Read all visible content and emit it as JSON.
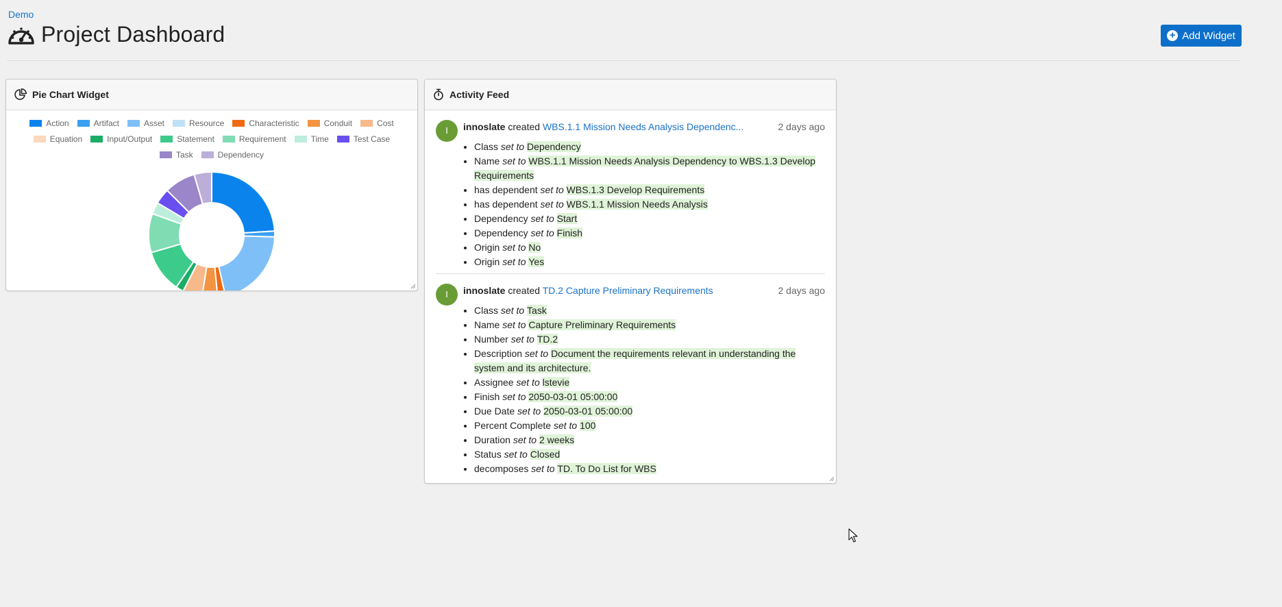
{
  "breadcrumb": "Demo",
  "page_title": "Project Dashboard",
  "add_widget_label": "Add Widget",
  "pie_widget": {
    "title": "Pie Chart Widget",
    "chart_data": {
      "type": "pie",
      "legend_placement": "top",
      "categories": [
        "Action",
        "Artifact",
        "Asset",
        "Resource",
        "Characteristic",
        "Conduit",
        "Cost",
        "Equation",
        "Input/Output",
        "Statement",
        "Requirement",
        "Time",
        "Test Case",
        "Task",
        "Dependency"
      ],
      "values": [
        24,
        1.5,
        21,
        0,
        2,
        4,
        5,
        0,
        2,
        11,
        10,
        3,
        4,
        8,
        4.5
      ],
      "colors": [
        "#0a84ec",
        "#3aa0f0",
        "#7fbff7",
        "#bfe0f7",
        "#ef6a12",
        "#f29442",
        "#f7b98a",
        "#fbd9bd",
        "#1aad66",
        "#3ccb8a",
        "#7fdcb3",
        "#bdeedb",
        "#6a4ff0",
        "#9a86c9",
        "#bcaed9"
      ]
    }
  },
  "activity_feed": {
    "title": "Activity Feed",
    "set_to_label": "set to",
    "entries": [
      {
        "avatar": "I",
        "user": "innoslate",
        "verb": "created",
        "target": "WBS.1.1 Mission Needs Analysis Dependenc...",
        "time": "2 days ago",
        "changes": [
          {
            "field": "Class",
            "value": "Dependency"
          },
          {
            "field": "Name",
            "value": "WBS.1.1 Mission Needs Analysis Dependency to WBS.1.3 Develop Requirements"
          },
          {
            "field": "has dependent",
            "value": "WBS.1.3 Develop Requirements"
          },
          {
            "field": "has dependent",
            "value": "WBS.1.1 Mission Needs Analysis"
          },
          {
            "field": "Dependency",
            "value": "Start"
          },
          {
            "field": "Dependency",
            "value": "Finish"
          },
          {
            "field": "Origin",
            "value": "No"
          },
          {
            "field": "Origin",
            "value": "Yes"
          }
        ]
      },
      {
        "avatar": "I",
        "user": "innoslate",
        "verb": "created",
        "target": "TD.2 Capture Preliminary Requirements",
        "time": "2 days ago",
        "changes": [
          {
            "field": "Class",
            "value": "Task"
          },
          {
            "field": "Name",
            "value": "Capture Preliminary Requirements"
          },
          {
            "field": "Number",
            "value": "TD.2"
          },
          {
            "field": "Description",
            "value": "Document the requirements relevant in understanding the system and its architecture."
          },
          {
            "field": "Assignee",
            "value": "lstevie"
          },
          {
            "field": "Finish",
            "value": "2050-03-01 05:00:00"
          },
          {
            "field": "Due Date",
            "value": "2050-03-01 05:00:00"
          },
          {
            "field": "Percent Complete",
            "value": "100"
          },
          {
            "field": "Duration",
            "value": "2 weeks"
          },
          {
            "field": "Status",
            "value": "Closed"
          },
          {
            "field": "decomposes",
            "value": "TD. To Do List for WBS"
          }
        ]
      }
    ]
  }
}
